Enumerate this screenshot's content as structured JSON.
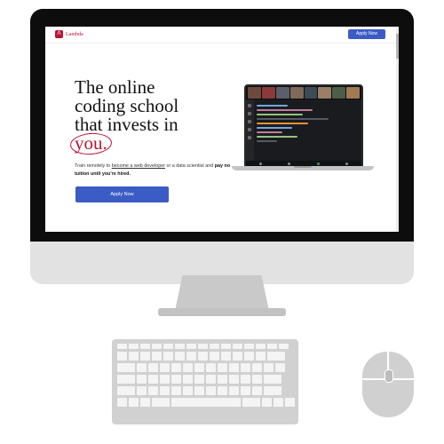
{
  "nav": {
    "logo_text": "Lambda",
    "logo_glyph": "Λ",
    "apply_label": "Apply Now"
  },
  "hero": {
    "headline_line1": "The online",
    "headline_line2": "coding school",
    "headline_line3": "that invests in",
    "headline_highlight": "you.",
    "subtext_a": "Train remotely to ",
    "subtext_link1": "become a web developer",
    "subtext_b": " or a data scientist and ",
    "subtext_bold": "pay no tuition until you're hired.",
    "apply_label": "Apply Now"
  },
  "colors": {
    "brand_red": "#bb1333",
    "button_blue": "#3b5cc4",
    "bezel": "#0d0d0d",
    "chin": "#e2e2e2"
  },
  "icons": {
    "logo": "lambda-logo-icon",
    "mouse": "mouse-icon",
    "keyboard": "keyboard-icon"
  }
}
